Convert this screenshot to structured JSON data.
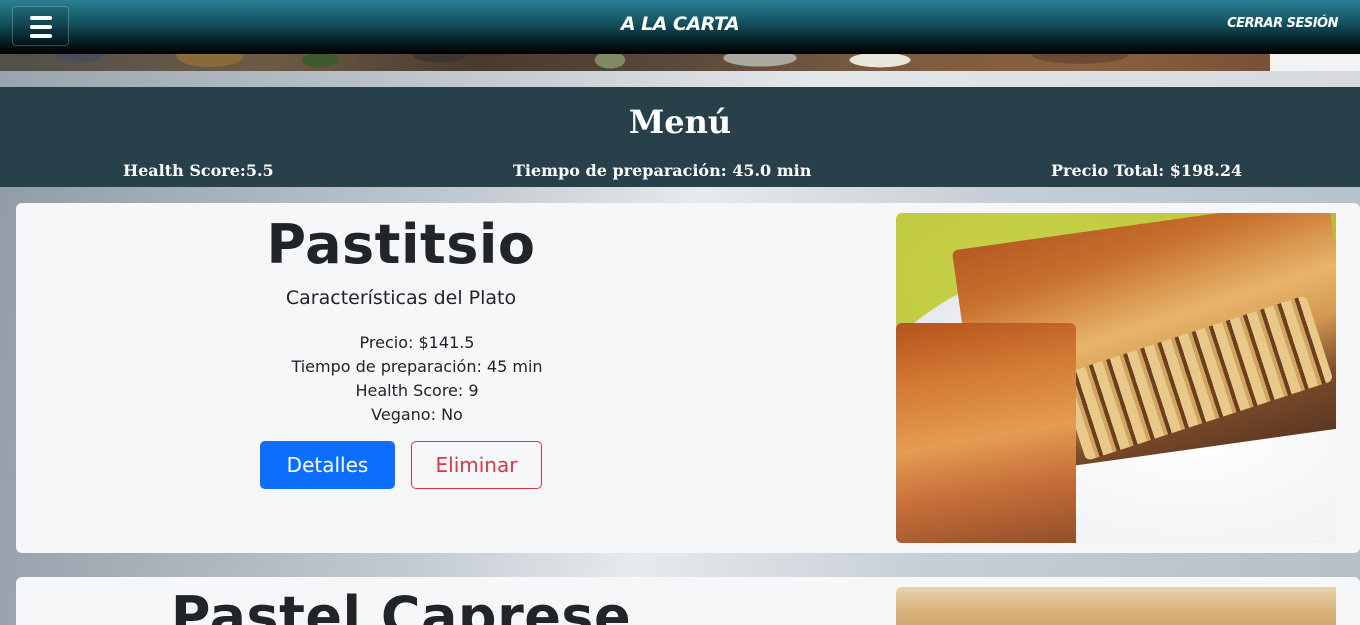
{
  "navbar": {
    "brand": "A LA CARTA",
    "logout_label": "CERRAR SESIÓN"
  },
  "menu_summary": {
    "title": "Menú",
    "health_score": "Health Score:5.5",
    "prep_time": "Tiempo de preparación: 45.0 min",
    "total_price": "Precio Total: $198.24"
  },
  "dishes": [
    {
      "name": "Pastitsio",
      "subtitle": "Características del Plato",
      "price": "Precio: $141.5",
      "prep_time": "Tiempo de preparación: 45 min",
      "health_score": "Health Score: 9",
      "vegan": "Vegano: No",
      "details_label": "Detalles",
      "delete_label": "Eliminar"
    },
    {
      "name": "Pastel Caprese"
    }
  ],
  "icons": {
    "menu": "hamburger-icon"
  },
  "colors": {
    "summary_bg": "#27404a",
    "primary": "#0d6efd",
    "danger": "#dc3545",
    "card_bg": "#f6f7f9"
  }
}
